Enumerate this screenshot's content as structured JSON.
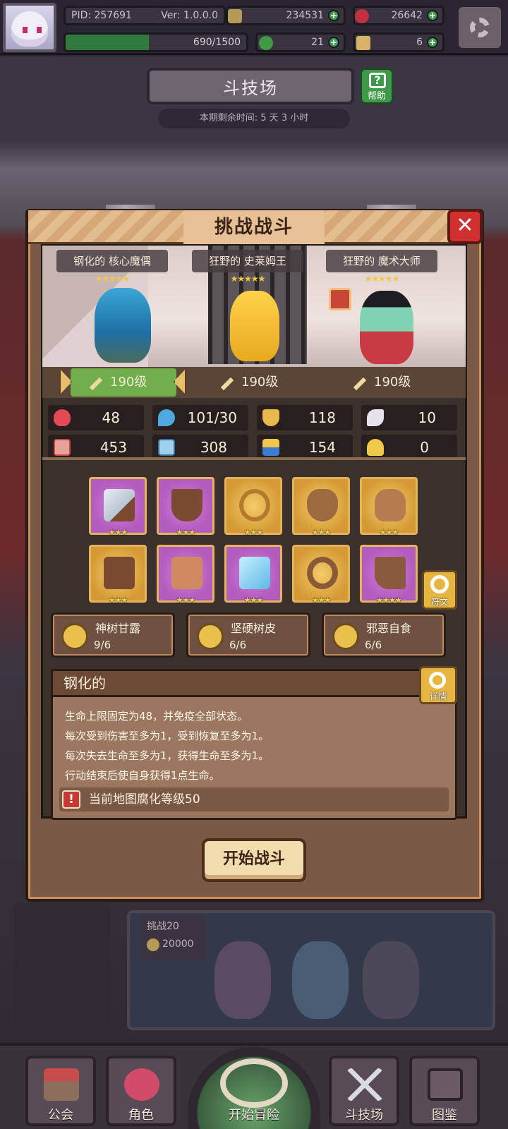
{
  "header": {
    "pid": "PID: 257691",
    "version": "Ver: 1.0.0.0",
    "coins": "234531",
    "gems": "26642",
    "exp": "690/1500",
    "clover": "21",
    "keys": "6",
    "exp_progress": 0.46
  },
  "arena": {
    "title": "斗技场",
    "help_label": "帮助",
    "remaining": "本期剩余时间: 5 天 3 小时"
  },
  "modal": {
    "title": "挑战战斗",
    "enemies": [
      {
        "name": "钢化的 核心魔偶",
        "stars": "★★★★★",
        "level": "190级"
      },
      {
        "name": "狂野的 史莱姆王",
        "stars": "★★★★★",
        "level": "190级"
      },
      {
        "name": "狂野的 魔术大师",
        "stars": "★★★★★",
        "level": "190级"
      }
    ],
    "stats": [
      {
        "icon": "heart-icon",
        "value": "48"
      },
      {
        "icon": "water-drop-icon",
        "value": "101/30"
      },
      {
        "icon": "shield-icon",
        "value": "118"
      },
      {
        "icon": "wing-icon",
        "value": "10"
      },
      {
        "icon": "fist-icon",
        "value": "453"
      },
      {
        "icon": "book-icon",
        "value": "308"
      },
      {
        "icon": "scroll-icon",
        "value": "154"
      },
      {
        "icon": "horseshoe-icon",
        "value": "0"
      }
    ],
    "items": [
      {
        "icon": "cleaver-icon",
        "stars": "★★★",
        "rarity": "epic"
      },
      {
        "icon": "wooden-shield-icon",
        "stars": "★★★",
        "rarity": "epic"
      },
      {
        "icon": "gold-necklace-icon",
        "stars": "★★★",
        "rarity": "legendary"
      },
      {
        "icon": "clay-pot-icon",
        "stars": "★★★",
        "rarity": "legendary"
      },
      {
        "icon": "jar-icon",
        "stars": "★★★",
        "rarity": "legendary"
      },
      {
        "icon": "wooden-armor-icon",
        "stars": "★★★",
        "rarity": "legendary"
      },
      {
        "icon": "leather-vest-icon",
        "stars": "★★★",
        "rarity": "epic"
      },
      {
        "icon": "ice-gauntlet-icon",
        "stars": "★★★",
        "rarity": "epic"
      },
      {
        "icon": "wooden-ring-icon",
        "stars": "★★★",
        "rarity": "legendary"
      },
      {
        "icon": "leather-boots-icon",
        "stars": "★★★★",
        "rarity": "epic"
      }
    ],
    "rune_label": "符文",
    "skills": [
      {
        "name": "神树甘露",
        "count": "9/6"
      },
      {
        "name": "坚硬树皮",
        "count": "6/6"
      },
      {
        "name": "邪恶自食",
        "count": "6/6"
      }
    ],
    "desc_title": "钢化的",
    "detail_label": "详情",
    "desc_lines": [
      "生命上限固定为48，并免疫全部状态。",
      "每次受到伤害至多为1，受到恢复至多为1。",
      "每次失去生命至多为1，获得生命至多为1。",
      "行动结束后使自身获得1点生命。"
    ],
    "corruption": "当前地图腐化等级50",
    "start_button": "开始战斗"
  },
  "background": {
    "challenge_label": "挑战20",
    "challenge_cost": "20000"
  },
  "nav": {
    "items": [
      {
        "label": "公会",
        "icon": "guild-house-icon"
      },
      {
        "label": "角色",
        "icon": "character-icon"
      },
      {
        "label": "开始冒险",
        "icon": "magnifier-globe-icon"
      },
      {
        "label": "斗技场",
        "icon": "crossed-swords-icon"
      },
      {
        "label": "图鉴",
        "icon": "codex-book-icon"
      }
    ]
  }
}
